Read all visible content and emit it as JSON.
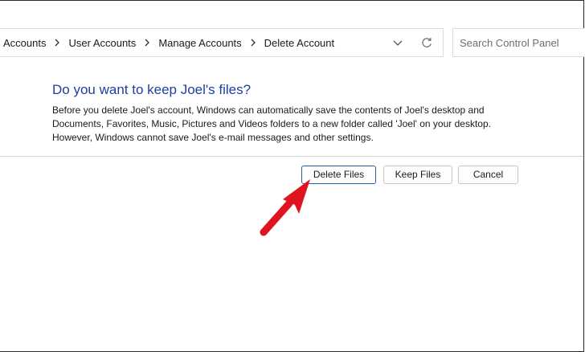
{
  "breadcrumb": {
    "items": [
      "Accounts",
      "User Accounts",
      "Manage Accounts",
      "Delete Account"
    ]
  },
  "search": {
    "placeholder": "Search Control Panel"
  },
  "dialog": {
    "heading": "Do you want to keep Joel's files?",
    "description": "Before you delete Joel's account, Windows can automatically save the contents of Joel's desktop and Documents, Favorites, Music, Pictures and Videos folders to a new folder called 'Joel' on your desktop. However, Windows cannot save Joel's e-mail messages and other settings."
  },
  "buttons": {
    "delete_files": "Delete Files",
    "keep_files": "Keep Files",
    "cancel": "Cancel"
  },
  "icons": {
    "breadcrumb_separator": "chevron-right-icon",
    "address_dropdown": "chevron-down-icon",
    "refresh": "refresh-icon",
    "annotation": "red-arrow-icon"
  },
  "colors": {
    "heading": "#1e3f9e",
    "default_button_border": "#1f5fa8",
    "annotation_arrow": "#e0141e"
  }
}
